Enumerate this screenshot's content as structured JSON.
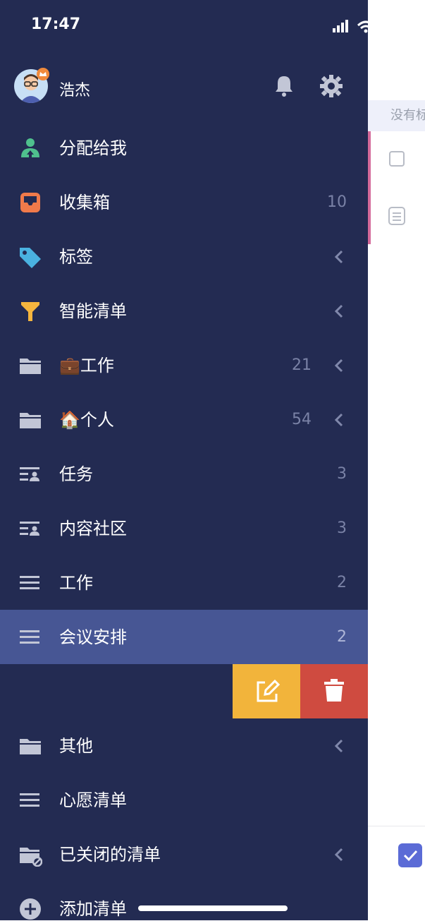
{
  "status_bar": {
    "time": "17:47"
  },
  "profile": {
    "name": "浩杰"
  },
  "sidebar": {
    "items": [
      {
        "label": "分配给我",
        "count": "",
        "icon": "assigned-user-icon"
      },
      {
        "label": "收集箱",
        "count": "10",
        "icon": "inbox-icon"
      },
      {
        "label": "标签",
        "count": "",
        "icon": "tag-icon"
      },
      {
        "label": "智能清单",
        "count": "",
        "icon": "filter-icon"
      },
      {
        "label": "💼工作",
        "count": "21",
        "icon": "folder-icon"
      },
      {
        "label": "🏠个人",
        "count": "54",
        "icon": "folder-icon"
      },
      {
        "label": "任务",
        "count": "3",
        "icon": "shared-list-icon"
      },
      {
        "label": "内容社区",
        "count": "3",
        "icon": "shared-list-icon"
      },
      {
        "label": "工作",
        "count": "2",
        "icon": "list-icon"
      },
      {
        "label": "会议安排",
        "count": "2",
        "icon": "list-icon"
      },
      {
        "label": "其他",
        "count": "",
        "icon": "folder-icon"
      },
      {
        "label": "心愿清单",
        "count": "",
        "icon": "list-icon"
      },
      {
        "label": "已关闭的清单",
        "count": "",
        "icon": "closed-folder-icon"
      },
      {
        "label": "添加清单",
        "count": "",
        "icon": "add-circle-icon"
      }
    ]
  },
  "swipe_actions": {
    "edit_icon": "edit-icon",
    "delete_icon": "trash-icon"
  },
  "background_page": {
    "filter_text": "没有标"
  },
  "colors": {
    "drawer_bg": "#232b52",
    "selected_bg": "#475694",
    "edit": "#f2b43b",
    "delete": "#cf4b40",
    "accent": "#5b6bd6"
  }
}
